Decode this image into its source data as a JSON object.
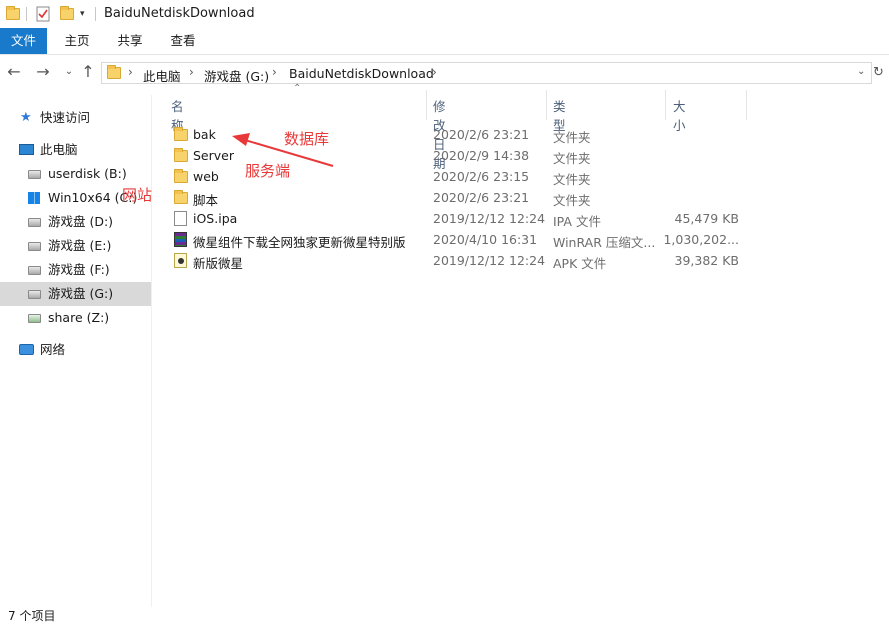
{
  "window": {
    "title": "BaiduNetdiskDownload"
  },
  "ribbon": {
    "tabs": [
      "文件",
      "主页",
      "共享",
      "查看"
    ]
  },
  "address": {
    "path": [
      "此电脑",
      "游戏盘 (G:)",
      "BaiduNetdiskDownload"
    ]
  },
  "sidebar": {
    "items": [
      {
        "label": "快速访问",
        "icon": "star-icon"
      },
      {
        "label": "此电脑",
        "icon": "pc-icon"
      },
      {
        "label": "userdisk (B:)",
        "icon": "drive-icon"
      },
      {
        "label": "Win10x64 (C:)",
        "icon": "windows-drive-icon"
      },
      {
        "label": "游戏盘 (D:)",
        "icon": "drive-icon"
      },
      {
        "label": "游戏盘 (E:)",
        "icon": "drive-icon"
      },
      {
        "label": "游戏盘 (F:)",
        "icon": "drive-icon"
      },
      {
        "label": "游戏盘 (G:)",
        "icon": "drive-icon",
        "selected": true
      },
      {
        "label": "share (Z:)",
        "icon": "network-drive-icon"
      },
      {
        "label": "网络",
        "icon": "network-icon"
      }
    ]
  },
  "columns": {
    "name": "名称",
    "modified": "修改日期",
    "type": "类型",
    "size": "大小"
  },
  "files": [
    {
      "name": "bak",
      "modified": "2020/2/6 23:21",
      "type": "文件夹",
      "size": "",
      "icon": "folder-icon"
    },
    {
      "name": "Server",
      "modified": "2020/2/9 14:38",
      "type": "文件夹",
      "size": "",
      "icon": "folder-icon"
    },
    {
      "name": "web",
      "modified": "2020/2/6 23:15",
      "type": "文件夹",
      "size": "",
      "icon": "folder-icon"
    },
    {
      "name": "脚本",
      "modified": "2020/2/6 23:21",
      "type": "文件夹",
      "size": "",
      "icon": "folder-icon"
    },
    {
      "name": "iOS.ipa",
      "modified": "2019/12/12 12:24",
      "type": "IPA 文件",
      "size": "45,479 KB",
      "icon": "file-icon"
    },
    {
      "name": "微星组件下载全网独家更新微星特别版",
      "modified": "2020/4/10 16:31",
      "type": "WinRAR 压缩文...",
      "size": "1,030,202...",
      "icon": "rar-icon"
    },
    {
      "name": "新版微星",
      "modified": "2019/12/12 12:24",
      "type": "APK 文件",
      "size": "39,382 KB",
      "icon": "apk-icon"
    }
  ],
  "annotations": {
    "database": "数据库",
    "server": "服务端",
    "website": "网站"
  },
  "status": {
    "count": "7 个项目"
  },
  "colors": {
    "accent": "#1979ca",
    "annotation": "#e8393a",
    "selected": "#d9d9d9"
  }
}
